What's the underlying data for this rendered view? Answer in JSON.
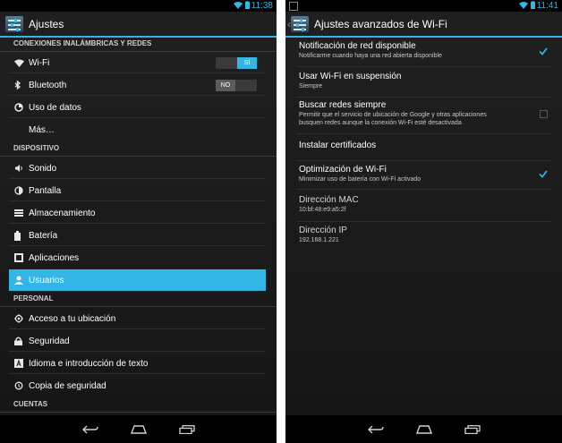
{
  "left": {
    "time": "11:38",
    "title": "Ajustes",
    "sections": {
      "wireless": "CONEXIONES INALÁMBRICAS Y REDES",
      "device": "DISPOSITIVO",
      "personal": "PERSONAL",
      "accounts": "CUENTAS"
    },
    "items": {
      "wifi": "Wi-Fi",
      "bluetooth": "Bluetooth",
      "data_usage": "Uso de datos",
      "more": "Más…",
      "sound": "Sonido",
      "display": "Pantalla",
      "storage": "Almacenamiento",
      "battery": "Batería",
      "apps": "Aplicaciones",
      "users": "Usuarios",
      "location": "Acceso a tu ubicación",
      "security": "Seguridad",
      "language": "Idioma e introducción de texto",
      "backup": "Copia de seguridad"
    },
    "toggles": {
      "wifi": "SÍ",
      "bluetooth": "NO"
    }
  },
  "right": {
    "time": "11:41",
    "title": "Ajustes avanzados de Wi-Fi",
    "prefs": {
      "notify_title": "Notificación de red disponible",
      "notify_sub": "Notificarme cuando haya una red abierta disponible",
      "sleep_title": "Usar Wi-Fi en suspensión",
      "sleep_sub": "Siempre",
      "scan_title": "Buscar redes siempre",
      "scan_sub_1": "Permitir que el servicio de ubicación de Google y otras aplicaciones",
      "scan_sub_2": "busquen redes aunque la conexión Wi-Fi esté desactivada",
      "certs_title": "Instalar certificados",
      "opt_title": "Optimización de Wi-Fi",
      "opt_sub": "Minimizar uso de batería con Wi-Fi activado",
      "mac_title": "Dirección MAC",
      "mac_value": "10:bf:48:e9:a5:2f",
      "ip_title": "Dirección IP",
      "ip_value": "192.168.1.221"
    }
  },
  "colors": {
    "accent": "#33b5e5",
    "background": "#1d1d1d"
  }
}
